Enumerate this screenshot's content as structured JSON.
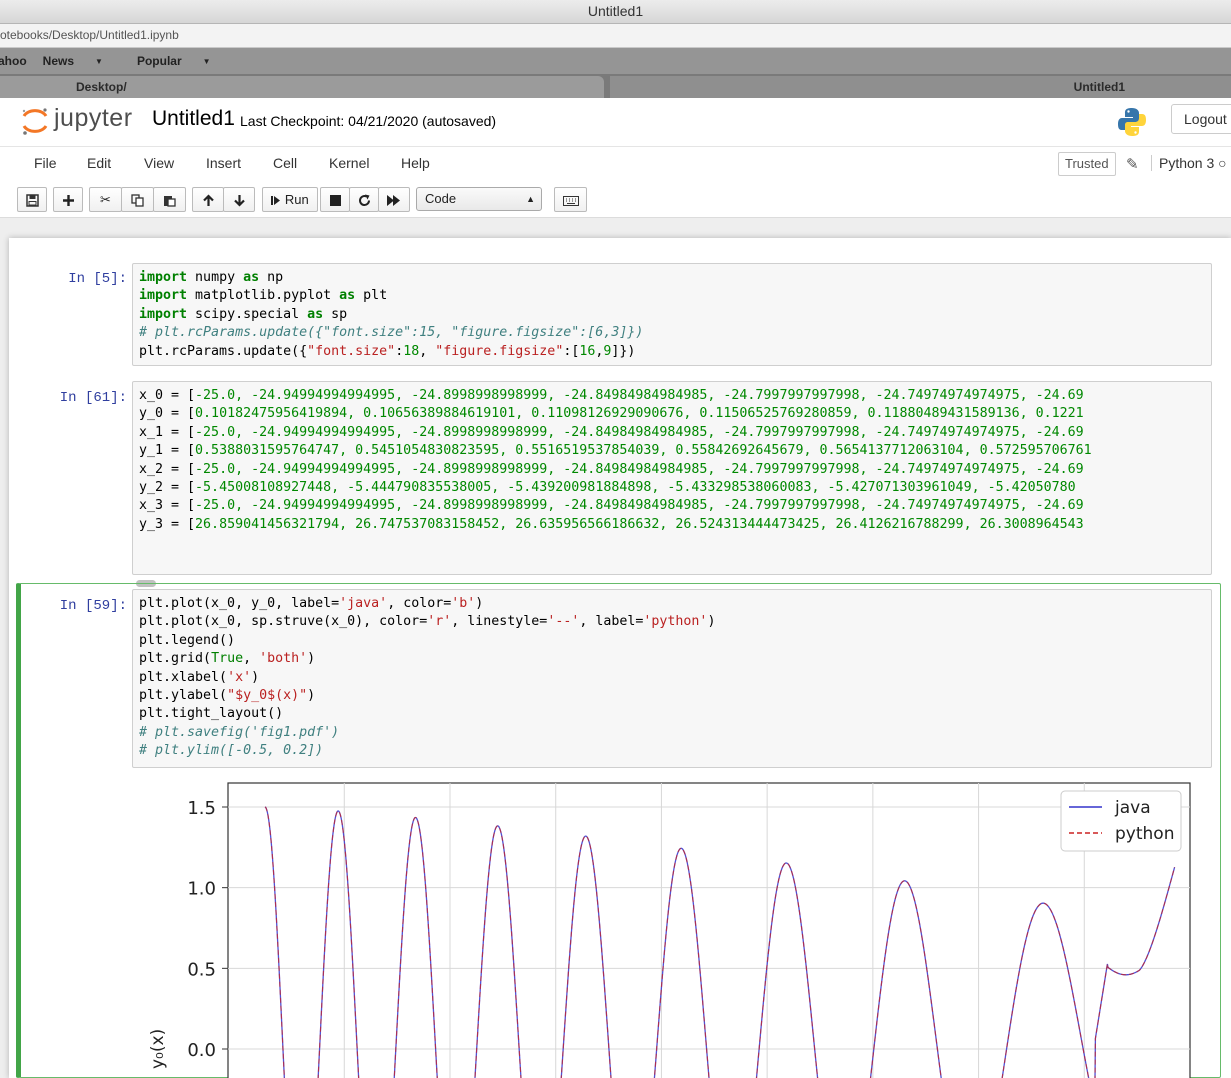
{
  "window": {
    "title": "Untitled1",
    "url": "otebooks/Desktop/Untitled1.ipynb"
  },
  "bookmarks": [
    "ahoo",
    "News",
    "Popular"
  ],
  "tabs": [
    "Desktop/",
    "Untitled1"
  ],
  "header": {
    "logo_text": "jupyter",
    "notebook_name": "Untitled1",
    "checkpoint": "Last Checkpoint: 04/21/2020  (autosaved)",
    "logout": "Logout"
  },
  "menu": {
    "items": [
      "File",
      "Edit",
      "View",
      "Insert",
      "Cell",
      "Kernel",
      "Help"
    ],
    "trusted": "Trusted",
    "kernel": "Python 3"
  },
  "toolbar": {
    "run_label": "Run",
    "cell_type": "Code"
  },
  "cells": [
    {
      "prompt": "In [5]:",
      "lines": [
        [
          [
            "kw",
            "import"
          ],
          [
            "t",
            " numpy "
          ],
          [
            "kw",
            "as"
          ],
          [
            "t",
            " np"
          ]
        ],
        [
          [
            "kw",
            "import"
          ],
          [
            "t",
            " matplotlib.pyplot "
          ],
          [
            "kw",
            "as"
          ],
          [
            "t",
            " plt"
          ]
        ],
        [
          [
            "kw",
            "import"
          ],
          [
            "t",
            " scipy.special "
          ],
          [
            "kw",
            "as"
          ],
          [
            "t",
            " sp"
          ]
        ],
        [
          [
            "cm",
            "# plt.rcParams.update({\"font.size\":15, \"figure.figsize\":[6,3]})"
          ]
        ],
        [
          [
            "t",
            "plt.rcParams.update({"
          ],
          [
            "st",
            "\"font.size\""
          ],
          [
            "t",
            ":"
          ],
          [
            "num",
            "18"
          ],
          [
            "t",
            ", "
          ],
          [
            "st",
            "\"figure.figsize\""
          ],
          [
            "t",
            ":["
          ],
          [
            "num",
            "16"
          ],
          [
            "t",
            ","
          ],
          [
            "num",
            "9"
          ],
          [
            "t",
            "]})"
          ]
        ]
      ]
    },
    {
      "prompt": "In [61]:",
      "lines": [
        [
          [
            "t",
            "x_0 = ["
          ],
          [
            "num",
            "-25.0, -24.94994994994995, -24.8998998998999, -24.84984984984985, -24.7997997997998, -24.74974974974975, -24.69"
          ]
        ],
        [
          [
            "t",
            "y_0 = ["
          ],
          [
            "num",
            "0.10182475956419894, 0.10656389884619101, 0.11098126929090676, 0.11506525769280859, 0.11880489431589136, 0.1221"
          ]
        ],
        [
          [
            "t",
            "x_1 = ["
          ],
          [
            "num",
            "-25.0, -24.94994994994995, -24.8998998998999, -24.84984984984985, -24.7997997997998, -24.74974974974975, -24.69"
          ]
        ],
        [
          [
            "t",
            "y_1 = ["
          ],
          [
            "num",
            "0.5388031595764747, 0.5451054830823595, 0.5516519537854039, 0.55842692645679, 0.5654137712063104, 0.572595706761"
          ]
        ],
        [
          [
            "t",
            "x_2 = ["
          ],
          [
            "num",
            "-25.0, -24.94994994994995, -24.8998998998999, -24.84984984984985, -24.7997997997998, -24.74974974974975, -24.69"
          ]
        ],
        [
          [
            "t",
            "y_2 = ["
          ],
          [
            "num",
            "-5.45008108927448, -5.444790835538005, -5.439200981884898, -5.433298538060083, -5.427071303961049, -5.42050780"
          ]
        ],
        [
          [
            "t",
            "x_3 = ["
          ],
          [
            "num",
            "-25.0, -24.94994994994995, -24.8998998998999, -24.84984984984985, -24.7997997997998, -24.74974974974975, -24.69"
          ]
        ],
        [
          [
            "t",
            "y_3 = ["
          ],
          [
            "num",
            "26.859041456321794, 26.747537083158452, 26.635956566186632, 26.524313444473425, 26.4126216788299, 26.3008964543"
          ]
        ]
      ]
    },
    {
      "prompt": "In [59]:",
      "lines": [
        [
          [
            "t",
            "plt.plot(x_0, y_0, label="
          ],
          [
            "st",
            "'java'"
          ],
          [
            "t",
            ", color="
          ],
          [
            "st",
            "'b'"
          ],
          [
            "t",
            ")"
          ]
        ],
        [
          [
            "t",
            "plt.plot(x_0, sp.struve(x_0), color="
          ],
          [
            "st",
            "'r'"
          ],
          [
            "t",
            ", linestyle="
          ],
          [
            "st",
            "'--'"
          ],
          [
            "t",
            ", label="
          ],
          [
            "st",
            "'python'"
          ],
          [
            "t",
            ")"
          ]
        ],
        [
          [
            "t",
            "plt.legend()"
          ]
        ],
        [
          [
            "t",
            "plt.grid("
          ],
          [
            "bi",
            "True"
          ],
          [
            "t",
            ", "
          ],
          [
            "st",
            "'both'"
          ],
          [
            "t",
            ")"
          ]
        ],
        [
          [
            "t",
            "plt.xlabel("
          ],
          [
            "st",
            "'x'"
          ],
          [
            "t",
            ")"
          ]
        ],
        [
          [
            "t",
            "plt.ylabel("
          ],
          [
            "st",
            "\"$y_0$(x)\""
          ],
          [
            "t",
            ")"
          ]
        ],
        [
          [
            "t",
            "plt.tight_layout()"
          ]
        ],
        [
          [
            "cm",
            "# plt.savefig('fig1.pdf')"
          ]
        ],
        [
          [
            "cm",
            "# plt.ylim([-0.5, 0.2])"
          ]
        ]
      ]
    }
  ],
  "chart_data": {
    "type": "line",
    "ylabel": "y₀(x)",
    "ylim": [
      -0.1,
      1.6
    ],
    "xlim": [
      -25.5,
      20
    ],
    "yticks": [
      0.0,
      0.5,
      1.0,
      1.5
    ],
    "ytick_labels": [
      "0.0",
      "0.5",
      "1.0",
      "1.5"
    ],
    "grid": true,
    "legend": "top-right",
    "series": [
      {
        "name": "java",
        "color": "#3333cc",
        "style": "solid"
      },
      {
        "name": "python",
        "color": "#cc2222",
        "style": "dashed"
      }
    ]
  }
}
